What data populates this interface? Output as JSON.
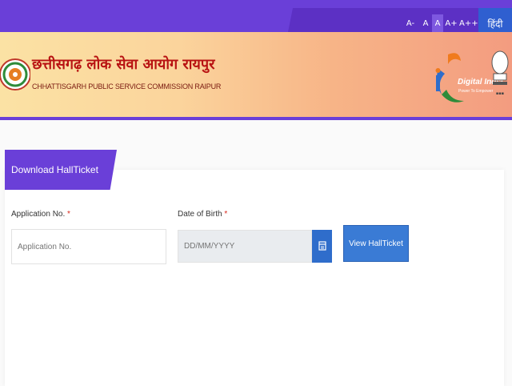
{
  "header": {
    "font_sizes": [
      "A-",
      "A",
      "A",
      "A+",
      "A++"
    ],
    "language_toggle": "हिंदी",
    "org_name_hindi": "छत्तीसगढ़ लोक सेवा आयोग रायपुर",
    "org_name_english": "CHHATTISGARH PUBLIC SERVICE COMMISSION RAIPUR",
    "digital_india": "Digital India",
    "digital_india_tagline": "Power To Empower"
  },
  "card": {
    "title": "Download HallTicket"
  },
  "form": {
    "application_label": "Application No.",
    "application_placeholder": "Application No.",
    "dob_label": "Date of Birth",
    "dob_placeholder": "DD/MM/YYYY",
    "required_mark": "*",
    "submit_label": "View HallTicket"
  },
  "colors": {
    "accent_purple": "#6a3fd8",
    "button_blue": "#3a7bd5",
    "required_red": "#d9281c"
  }
}
